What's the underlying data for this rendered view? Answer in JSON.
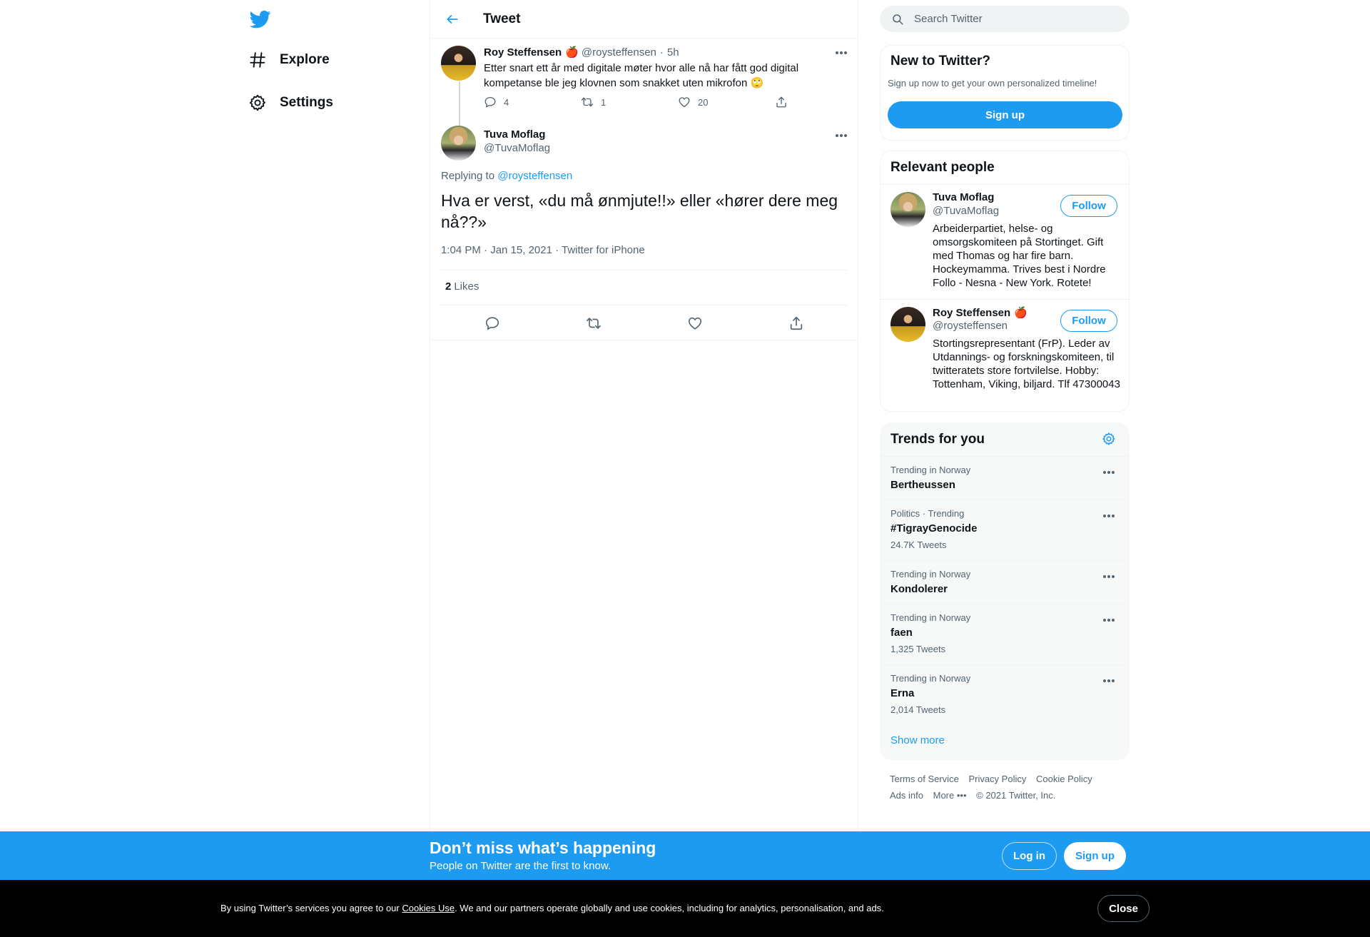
{
  "colors": {
    "accent": "#1d9bf0",
    "text": "#0f1419",
    "muted": "#536471",
    "cookie_bg": "#000000"
  },
  "nav": {
    "logo_icon": "twitter-bird-icon",
    "items": [
      {
        "label": "Explore",
        "icon": "hashtag-icon"
      },
      {
        "label": "Settings",
        "icon": "gear-icon"
      }
    ]
  },
  "header": {
    "title": "Tweet",
    "back_icon": "arrow-left-icon"
  },
  "parent_tweet": {
    "name": "Roy Steffensen",
    "handle": "@roysteffensen",
    "time": "5h",
    "emoji": "🍎",
    "text": "Etter snart ett år med digitale møter hvor alle nå har fått god digital kompetanse ble jeg klovnen som snakket uten mikrofon 🙄",
    "replies": "4",
    "retweets": "1",
    "likes": "20"
  },
  "main_tweet": {
    "name": "Tuva Moflag",
    "handle": "@TuvaMoflag",
    "replying_prefix": "Replying to",
    "replying_to": "@roysteffensen",
    "text": "Hva er verst, «du må ønmjute!!» eller «hører dere meg nå??»",
    "meta": "1:04 PM · Jan 15, 2021 · Twitter for iPhone",
    "likes_count": "2",
    "likes_label": "Likes"
  },
  "search": {
    "placeholder": "Search Twitter"
  },
  "new_to_twitter": {
    "title": "New to Twitter?",
    "subtitle": "Sign up now to get your own personalized timeline!",
    "button": "Sign up"
  },
  "relevant": {
    "title": "Relevant people",
    "people": [
      {
        "name": "Tuva Moflag",
        "handle": "@TuvaMoflag",
        "follow": "Follow",
        "bio": "Arbeiderpartiet, helse- og omsorgskomiteen på Stortinget. Gift med Thomas og har fire barn. Hockeymamma. Trives best i Nordre Follo - Nesna - New York. Rotete!"
      },
      {
        "name": "Roy Steffensen",
        "emoji": "🍎",
        "handle": "@roysteffensen",
        "follow": "Follow",
        "bio": "Stortingsrepresentant (FrP). Leder av Utdannings- og forskningskomiteen, til twitteratets store fortvilelse. Hobby: Tottenham, Viking, biljard. Tlf 47300043"
      }
    ]
  },
  "trends": {
    "title": "Trends for you",
    "items": [
      {
        "context": "Trending in Norway",
        "name": "Bertheussen",
        "count": ""
      },
      {
        "context": "Politics · Trending",
        "name": "#TigrayGenocide",
        "count": "24.7K Tweets"
      },
      {
        "context": "Trending in Norway",
        "name": "Kondolerer",
        "count": ""
      },
      {
        "context": "Trending in Norway",
        "name": "faen",
        "count": "1,325 Tweets"
      },
      {
        "context": "Trending in Norway",
        "name": "Erna",
        "count": "2,014 Tweets"
      }
    ],
    "show_more": "Show more"
  },
  "footer": {
    "links": [
      "Terms of Service",
      "Privacy Policy",
      "Cookie Policy",
      "Ads info",
      "More •••"
    ],
    "copyright": "© 2021 Twitter, Inc."
  },
  "bottom_bar": {
    "title": "Don’t miss what’s happening",
    "subtitle": "People on Twitter are the first to know.",
    "login": "Log in",
    "signup": "Sign up"
  },
  "cookie": {
    "prefix": "By using Twitter’s services you agree to our",
    "link": "Cookies Use",
    "suffix": ". We and our partners operate globally and use cookies, including for analytics, personalisation, and ads.",
    "close": "Close"
  }
}
